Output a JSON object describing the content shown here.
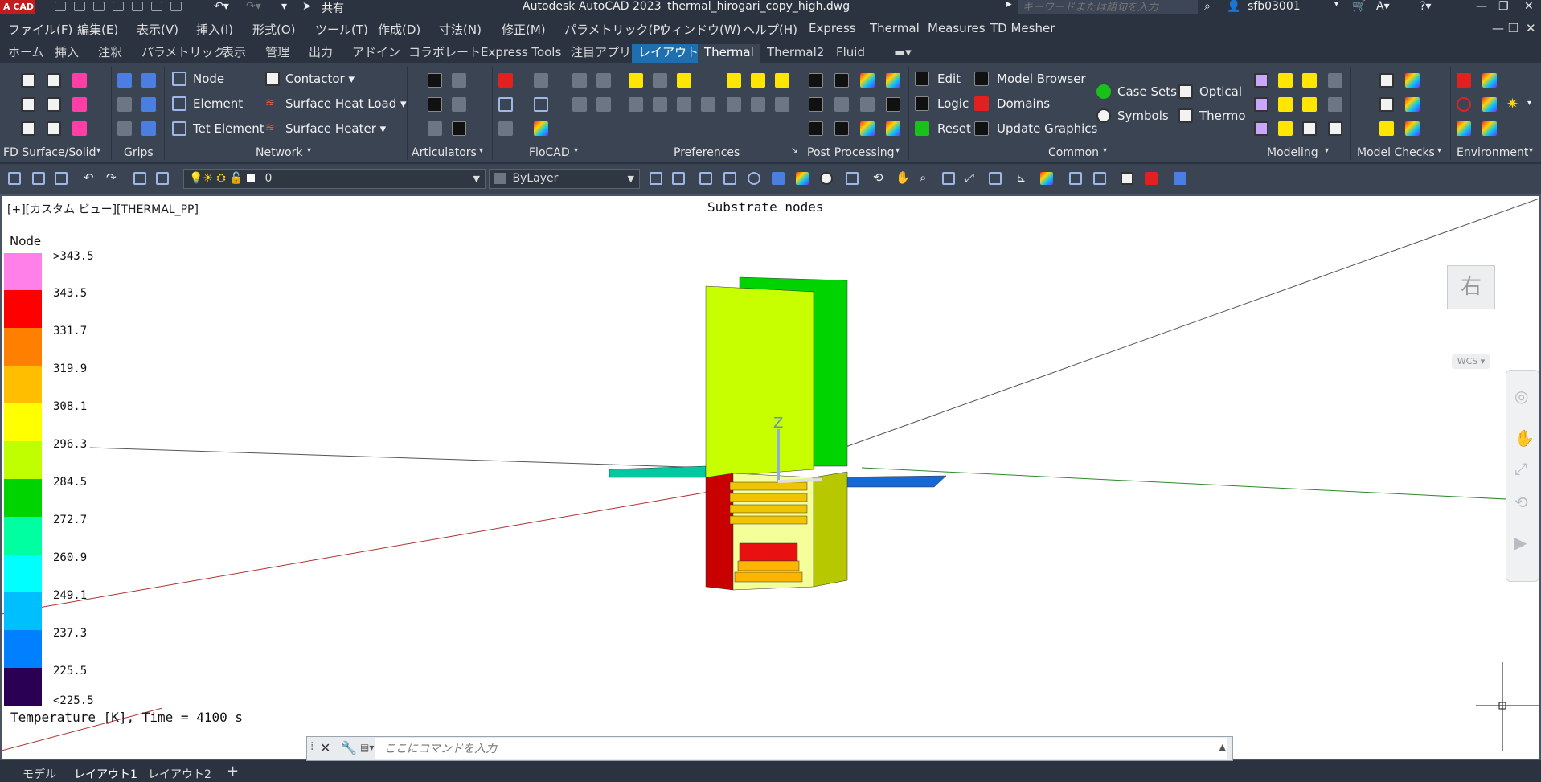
{
  "app": {
    "title": "Autodesk AutoCAD 2023",
    "filename": "thermal_hirogari_copy_high.dwg",
    "search_placeholder": "キーワードまたは語句を入力",
    "user": "sfb03001",
    "share_label": "共有"
  },
  "menubar": [
    "ファイル(F)",
    "編集(E)",
    "表示(V)",
    "挿入(I)",
    "形式(O)",
    "ツール(T)",
    "作成(D)",
    "寸法(N)",
    "修正(M)",
    "パラメトリック(P)",
    "ウィンドウ(W)",
    "ヘルプ(H)",
    "Express",
    "Thermal",
    "Measures",
    "TD Mesher"
  ],
  "ribbon_tabs": [
    "ホーム",
    "挿入",
    "注釈",
    "パラメトリック",
    "表示",
    "管理",
    "出力",
    "アドイン",
    "コラボレート",
    "Express Tools",
    "注目アプリ",
    "レイアウト",
    "Thermal",
    "Thermal2",
    "Fluid"
  ],
  "ribbon": {
    "network": {
      "node": "Node",
      "element": "Element",
      "tet_element": "Tet Element",
      "contactor": "Contactor",
      "surface_heat_load": "Surface Heat Load",
      "surface_heater": "Surface Heater"
    },
    "common": {
      "edit": "Edit",
      "logic": "Logic",
      "reset": "Reset",
      "model_browser": "Model Browser",
      "domains": "Domains",
      "update_graphics": "Update Graphics",
      "case_sets": "Case Sets",
      "symbols": "Symbols",
      "optical": "Optical",
      "thermo": "Thermo"
    },
    "panels": [
      "FD Surface/Solid",
      "Grips",
      "Network",
      "Articulators",
      "FloCAD",
      "Preferences",
      "Post Processing",
      "Common",
      "Modeling",
      "Model Checks",
      "Environment"
    ]
  },
  "toolbar": {
    "layer_value": "0",
    "linetype_value": "ByLayer"
  },
  "viewport": {
    "label": "[+][カスタム ビュー][THERMAL_PP]",
    "title": "Substrate nodes",
    "viewcube_face": "右",
    "wcs": "WCS"
  },
  "legend": {
    "title": "Node",
    "entries": [
      {
        "label": ">343.5",
        "color": "#ff80e8"
      },
      {
        "label": "343.5",
        "color": "#ff0000"
      },
      {
        "label": "331.7",
        "color": "#ff7f00"
      },
      {
        "label": "319.9",
        "color": "#ffbf00"
      },
      {
        "label": "308.1",
        "color": "#ffff00"
      },
      {
        "label": "296.3",
        "color": "#bfff00"
      },
      {
        "label": "284.5",
        "color": "#00d400"
      },
      {
        "label": "272.7",
        "color": "#00ffa0"
      },
      {
        "label": "260.9",
        "color": "#00ffff"
      },
      {
        "label": "249.1",
        "color": "#00bfff"
      },
      {
        "label": "237.3",
        "color": "#007fff"
      },
      {
        "label": "225.5",
        "color": "#2a0054"
      }
    ],
    "last_label": "<225.5"
  },
  "status_text": "Temperature [K], Time = 4100 s",
  "command_placeholder": "ここにコマンドを入力",
  "layout_tabs": [
    "モデル",
    "レイアウト1",
    "レイアウト2"
  ]
}
